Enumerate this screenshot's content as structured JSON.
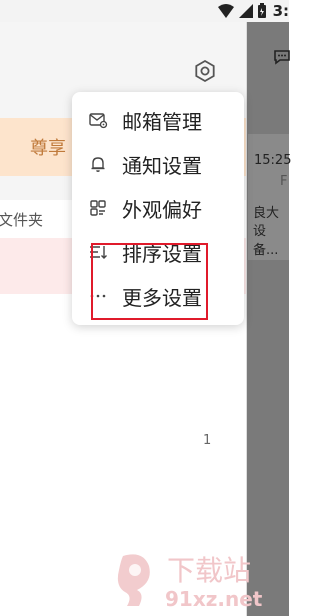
{
  "status_bar": {
    "time": "3:"
  },
  "sidebar": {
    "vip_banner_text": "尊享",
    "folder_text": "文件夹",
    "count": "1"
  },
  "right_panel": {
    "time": "15:25",
    "initial": "F",
    "preview_line1": "良大",
    "preview_line2": "设备..."
  },
  "menu": {
    "items": [
      {
        "label": "邮箱管理",
        "icon": "mailbox-settings-icon"
      },
      {
        "label": "通知设置",
        "icon": "bell-icon"
      },
      {
        "label": "外观偏好",
        "icon": "appearance-grid-icon"
      },
      {
        "label": "排序设置",
        "icon": "sort-icon"
      },
      {
        "label": "更多设置",
        "icon": "more-dots-icon"
      }
    ]
  },
  "watermark": {
    "brand": "下载站",
    "domain": "91xz.net"
  },
  "colors": {
    "highlight": "#e01a2b",
    "vip_text": "#c07a3b",
    "vip_bg": "#fde4cc",
    "pink_row": "#fdeaea"
  }
}
